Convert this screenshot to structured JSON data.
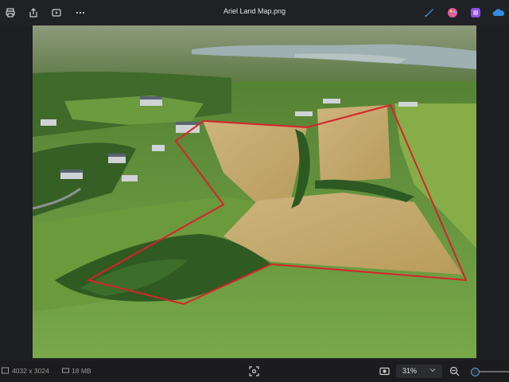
{
  "window": {
    "title": "Ariel Land Map.png",
    "toolbar_icons": [
      "print-icon",
      "share-icon",
      "slideshow-icon",
      "more-icon"
    ],
    "app_shortcuts": [
      "clipchamp-icon",
      "paint-icon",
      "designer-icon",
      "onedrive-icon"
    ]
  },
  "image": {
    "description_icon_names": [
      "aerial-photo"
    ],
    "colors": {
      "boundary": "#d8232a",
      "field": "#c8b275",
      "grass": "#6f9d3e",
      "trees": "#2f5a22"
    }
  },
  "status": {
    "dimensions": "4032 x 3024",
    "file_size": "18 MB",
    "zoom": "31%",
    "zoom_fraction": 0.31,
    "colors": {
      "accent": "#4c9be8"
    }
  }
}
